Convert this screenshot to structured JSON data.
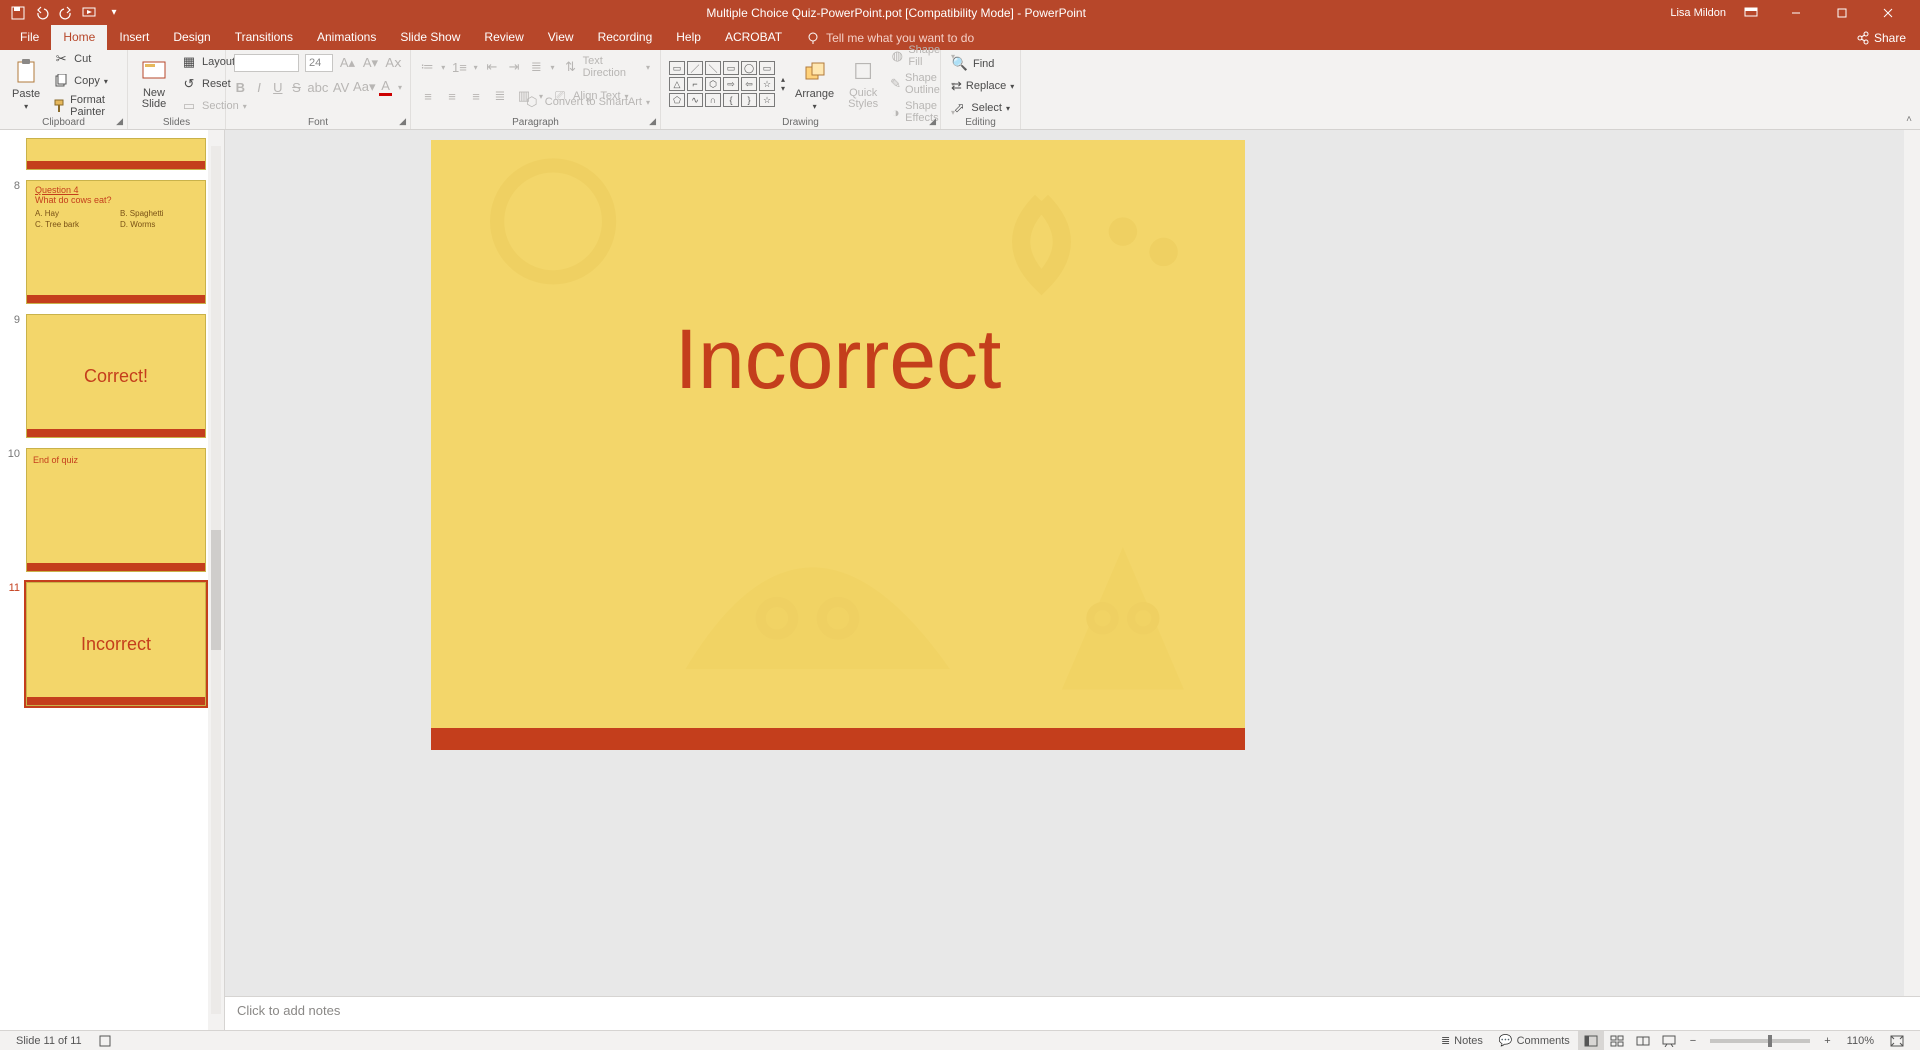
{
  "titlebar": {
    "doc_title": "Multiple Choice Quiz-PowerPoint.pot [Compatibility Mode]  -  PowerPoint",
    "user": "Lisa Mildon"
  },
  "tabs": {
    "file": "File",
    "home": "Home",
    "insert": "Insert",
    "design": "Design",
    "transitions": "Transitions",
    "animations": "Animations",
    "slideshow": "Slide Show",
    "review": "Review",
    "view": "View",
    "recording": "Recording",
    "help": "Help",
    "acrobat": "ACROBAT",
    "tellme": "Tell me what you want to do",
    "share": "Share"
  },
  "ribbon": {
    "clipboard": {
      "label": "Clipboard",
      "paste": "Paste",
      "cut": "Cut",
      "copy": "Copy",
      "fmt": "Format Painter"
    },
    "slides": {
      "label": "Slides",
      "new": "New\nSlide",
      "layout": "Layout",
      "reset": "Reset",
      "section": "Section"
    },
    "font": {
      "label": "Font",
      "size": "24"
    },
    "paragraph": {
      "label": "Paragraph",
      "textdir": "Text Direction",
      "align": "Align Text",
      "smartart": "Convert to SmartArt"
    },
    "drawing": {
      "label": "Drawing",
      "arrange": "Arrange",
      "quick": "Quick\nStyles",
      "fill": "Shape Fill",
      "outline": "Shape Outline",
      "effects": "Shape Effects"
    },
    "editing": {
      "label": "Editing",
      "find": "Find",
      "replace": "Replace",
      "select": "Select"
    }
  },
  "thumbs": {
    "t8_num": "8",
    "t8_title": "Question 4",
    "t8_sub": "What do cows eat?",
    "t8_a": "A.   Hay",
    "t8_b": "B.   Spaghetti",
    "t8_c": "C.   Tree bark",
    "t8_d": "D.   Worms",
    "t9_num": "9",
    "t9_text": "Correct!",
    "t10_num": "10",
    "t10_text": "End of quiz",
    "t11_num": "11",
    "t11_text": "Incorrect"
  },
  "slide": {
    "bigtext": "Incorrect"
  },
  "notes": {
    "placeholder": "Click to add notes"
  },
  "status": {
    "slidecount": "Slide 11 of 11",
    "notes": "Notes",
    "comments": "Comments",
    "zoom": "110%"
  }
}
